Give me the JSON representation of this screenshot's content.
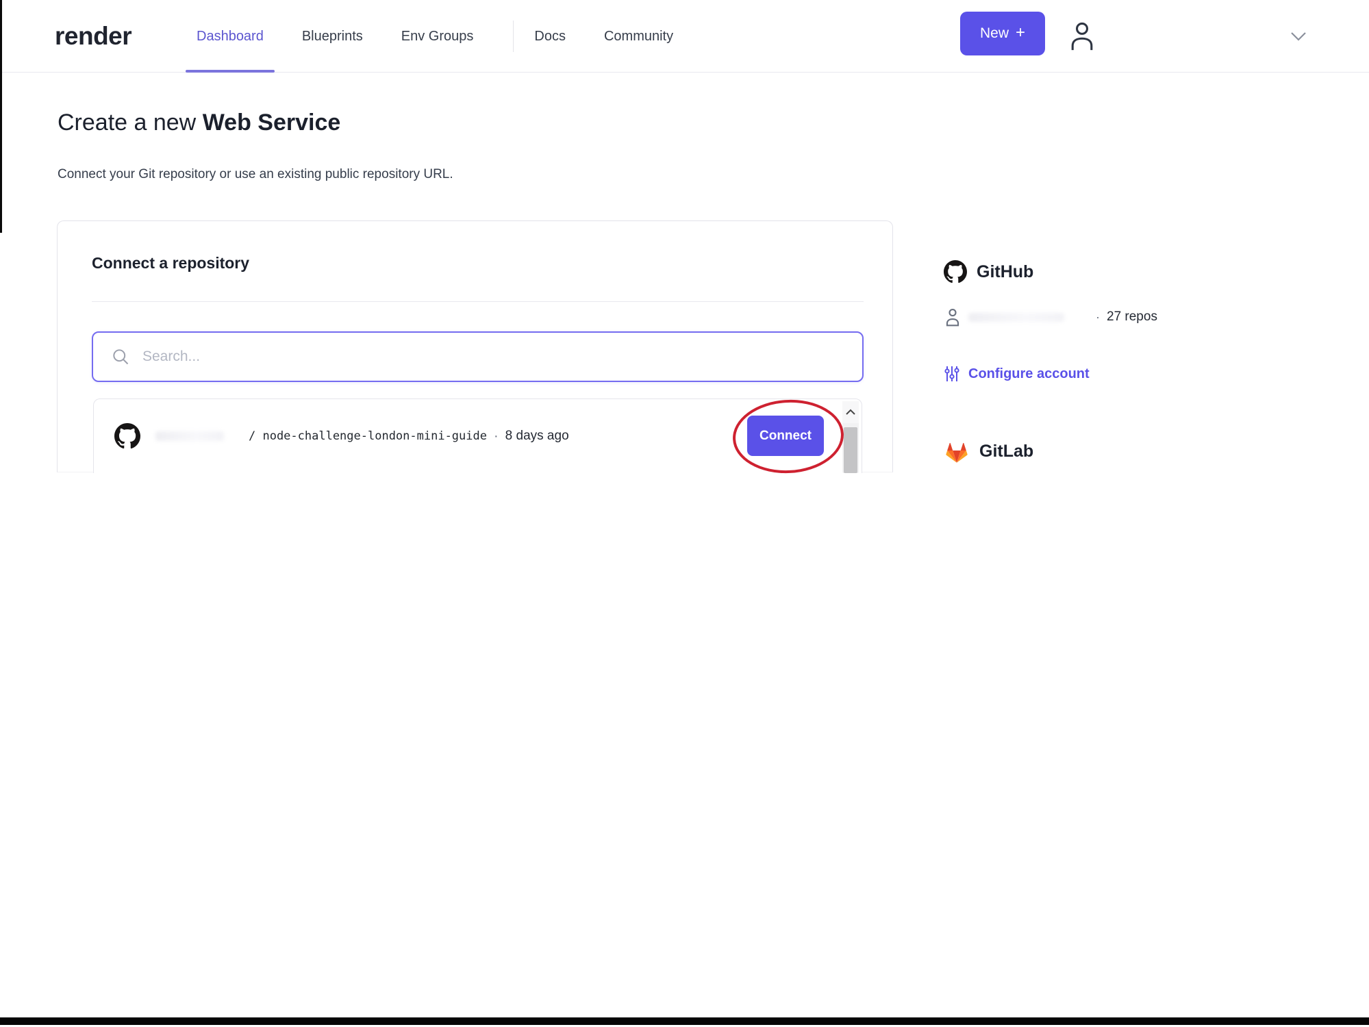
{
  "header": {
    "logo": "render",
    "nav": [
      {
        "label": "Dashboard"
      },
      {
        "label": "Blueprints"
      },
      {
        "label": "Env Groups"
      },
      {
        "label": "Docs"
      },
      {
        "label": "Community"
      }
    ],
    "new_button": {
      "label": "New",
      "plus": "+"
    }
  },
  "page": {
    "title_prefix": "Create a new",
    "title_emphasis": "Web Service",
    "subtitle": "Connect your Git repository or use an existing public repository URL."
  },
  "repo_card": {
    "heading": "Connect a repository",
    "search": {
      "placeholder": "Search..."
    },
    "repo_row": {
      "path": "/ node-challenge-london-mini-guide",
      "separator": "·",
      "updated": "8 days ago",
      "connect_label": "Connect"
    }
  },
  "providers": {
    "github": {
      "title": "GitHub",
      "account": {
        "separator": "·",
        "repo_count": "27 repos"
      },
      "configure_label": "Configure account"
    },
    "gitlab": {
      "title": "GitLab"
    }
  },
  "colors": {
    "accent": "#5a51e8",
    "annotation_red": "#ce2130",
    "gitlab_orange": "#fc6d26",
    "github_black": "#171515"
  }
}
